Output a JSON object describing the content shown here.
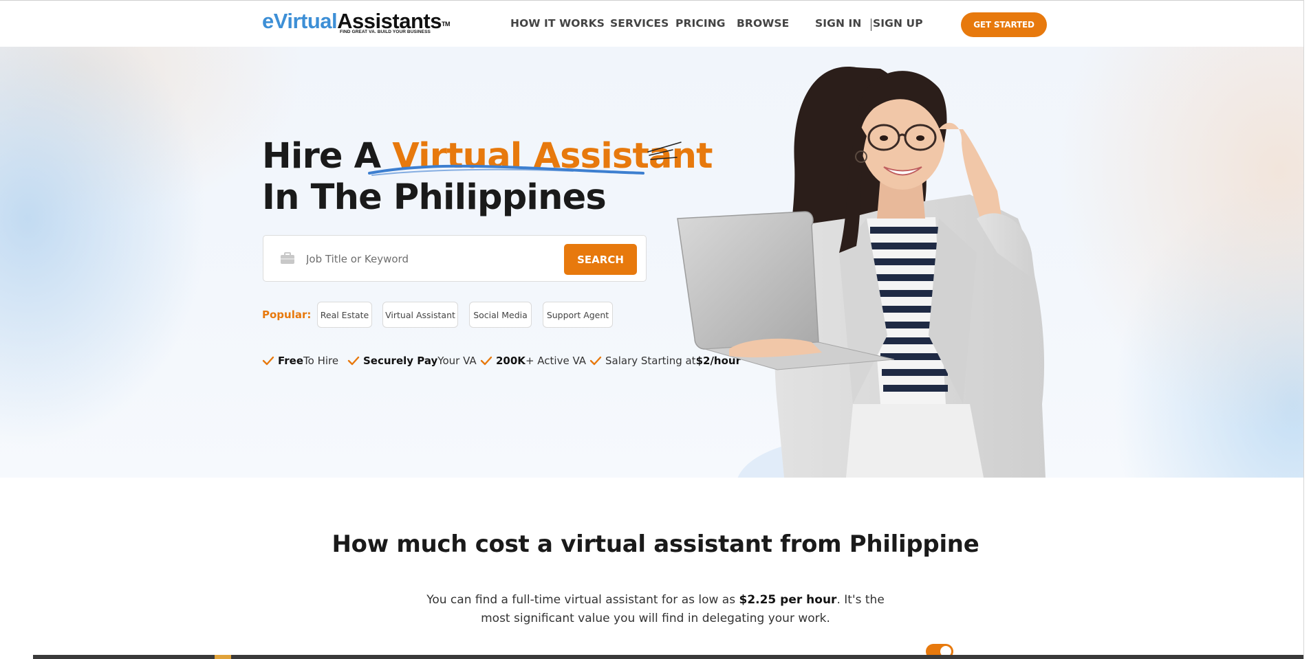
{
  "brand": {
    "logo_e": "eVirtual",
    "logo_main": "Assistants",
    "logo_tm": "TM",
    "tagline": "FIND GREAT VA. BUILD YOUR BUSINESS"
  },
  "nav": {
    "items": [
      {
        "label": "HOW IT WORKS"
      },
      {
        "label": "SERVICES"
      },
      {
        "label": "PRICING"
      },
      {
        "label": "BROWSE"
      }
    ],
    "sign_in": "SIGN IN",
    "sign_up": "SIGN UP",
    "cta": "GET STARTED"
  },
  "hero": {
    "title_prefix": "Hire A ",
    "title_accent": "Virtual Assistant",
    "title_line2": "In The Philippines",
    "search": {
      "placeholder": "Job Title or Keyword",
      "value": "",
      "button": "SEARCH"
    },
    "popular_label": "Popular:",
    "popular_tags": [
      "Real Estate",
      "Virtual Assistant",
      "Social Media",
      "Support Agent"
    ],
    "features": [
      {
        "bold": "Free",
        "rest": " To Hire"
      },
      {
        "bold": "Securely Pay",
        "rest": " Your VA"
      },
      {
        "bold": "200K",
        "rest": "+ Active VA"
      },
      {
        "prefix": "Salary Starting at ",
        "bold": "$2/hour"
      }
    ]
  },
  "cost_section": {
    "title": "How much cost a virtual assistant from Philippine",
    "text_before": "You can find a full-time virtual assistant for as low as ",
    "text_bold": "$2.25 per hour",
    "text_after": ". It's the most significant value you will find in delegating your work."
  },
  "colors": {
    "accent": "#e7790d",
    "logo_blue": "#3d8fd6",
    "text_dark": "#1a1a1a"
  },
  "icons": [
    "briefcase-icon",
    "check-icon",
    "underline-stroke",
    "spark-lines"
  ]
}
